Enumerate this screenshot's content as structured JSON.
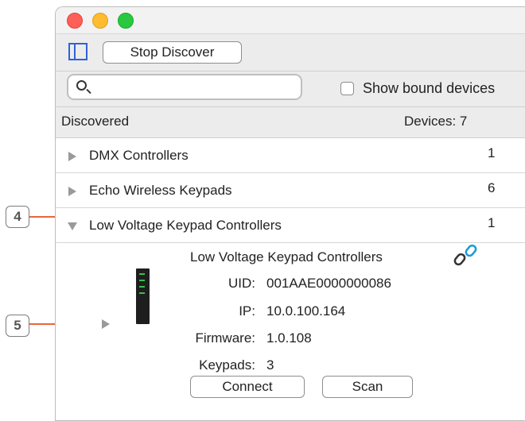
{
  "toolbar": {
    "stop_label": "Stop Discover"
  },
  "search": {
    "placeholder": ""
  },
  "filter": {
    "show_bound_label": "Show bound devices"
  },
  "header": {
    "label": "Discovered",
    "count": "Devices:  7"
  },
  "groups": [
    {
      "name": "DMX Controllers",
      "count": "1",
      "expanded": false
    },
    {
      "name": "Echo Wireless Keypads",
      "count": "6",
      "expanded": false
    },
    {
      "name": "Low Voltage Keypad Controllers",
      "count": "1",
      "expanded": true
    }
  ],
  "detail": {
    "title": "Low Voltage Keypad Controllers",
    "uid_label": "UID:",
    "uid": "001AAE0000000086",
    "ip_label": "IP:",
    "ip": "10.0.100.164",
    "firmware_label": "Firmware:",
    "firmware": "1.0.108",
    "keypads_label": "Keypads:",
    "keypads": "3",
    "connect_label": "Connect",
    "scan_label": "Scan"
  },
  "callouts": {
    "c4": "4",
    "c5": "5"
  },
  "icons": {
    "link": "link-icon",
    "search": "search-icon",
    "sidebar": "sidebar-toggle-icon"
  },
  "colors": {
    "accent": "#2f62d6",
    "callout_line": "#e8663a",
    "link_icon": "#1a9bd7"
  }
}
